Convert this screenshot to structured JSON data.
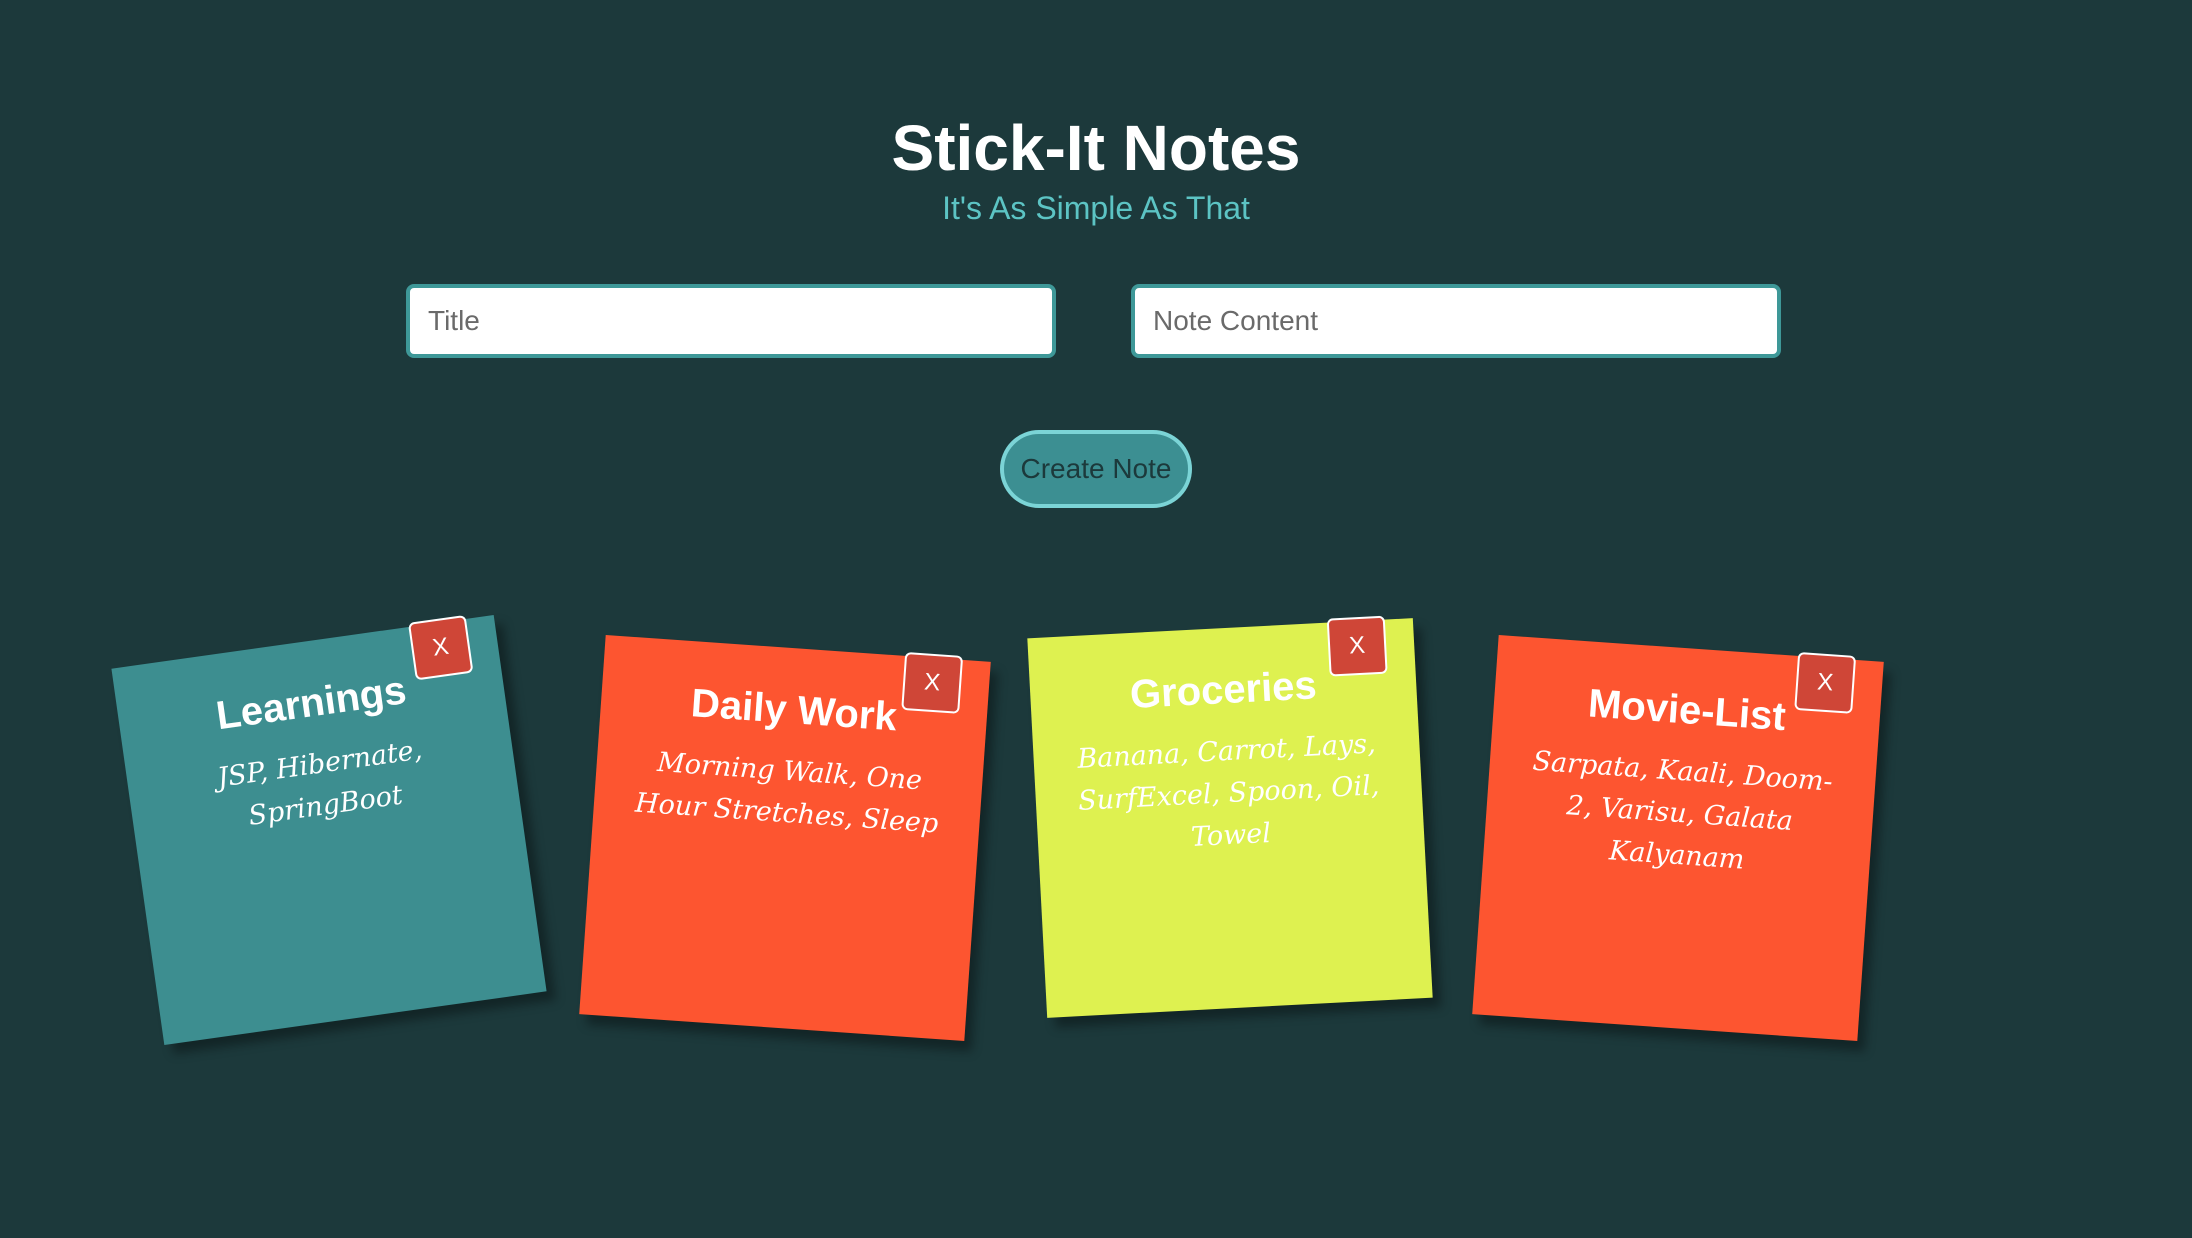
{
  "app": {
    "title": "Stick-It Notes",
    "subtitle": "It's As Simple As That"
  },
  "form": {
    "title_placeholder": "Title",
    "title_value": "",
    "content_placeholder": "Note Content",
    "content_value": "",
    "create_label": "Create Note"
  },
  "colors": {
    "background": "#1c393b",
    "accent": "#3e9898",
    "teal_note": "#3d8e90",
    "orange_note": "#fd5530",
    "yellow_note": "#def150",
    "delete_button": "#cf4637"
  },
  "notes": [
    {
      "title": "Learnings",
      "content": "JSP, Hibernate, SpringBoot",
      "color": "#3d8e90",
      "delete_label": "X"
    },
    {
      "title": "Daily Work",
      "content": "Morning Walk, One Hour Stretches, Sleep",
      "color": "#fd5530",
      "delete_label": "X"
    },
    {
      "title": "Groceries",
      "content": "Banana, Carrot, Lays, SurfExcel, Spoon, Oil, Towel",
      "color": "#def150",
      "delete_label": "X"
    },
    {
      "title": "Movie-List",
      "content": "Sarpata, Kaali, Doom-2, Varisu, Galata Kalyanam",
      "color": "#fd5530",
      "delete_label": "X"
    }
  ]
}
